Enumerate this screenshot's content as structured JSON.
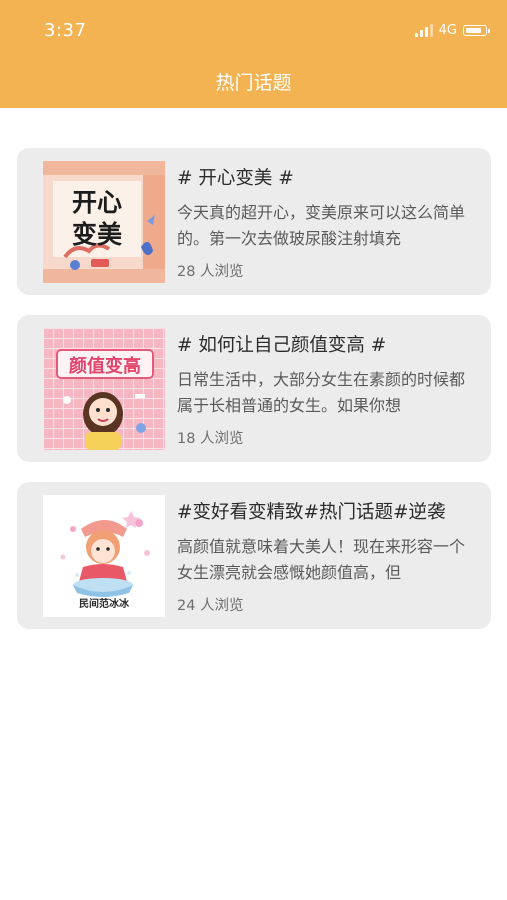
{
  "status_bar": {
    "time": "3:37",
    "network": "4G"
  },
  "header": {
    "title": "热门话题"
  },
  "topics": [
    {
      "title": "# 开心变美 #",
      "description": "今天真的超开心，变美原来可以这么简单的。第一次去做玻尿酸注射填充",
      "views": "28 人浏览",
      "image_text": [
        "开心",
        "变美"
      ]
    },
    {
      "title": "# 如何让自己颜值变高 #",
      "description": "日常生活中，大部分女生在素颜的时候都属于长相普通的女生。如果你想",
      "views": "18 人浏览",
      "image_text": [
        "颜值变高"
      ]
    },
    {
      "title": "#变好看变精致#热门话题#逆袭",
      "description": "高颜值就意味着大美人！现在来形容一个女生漂亮就会感慨她颜值高，但",
      "views": "24 人浏览",
      "image_text": [
        "民间范冰冰"
      ]
    }
  ],
  "colors": {
    "header": "#f3b352",
    "card": "#ececec"
  }
}
